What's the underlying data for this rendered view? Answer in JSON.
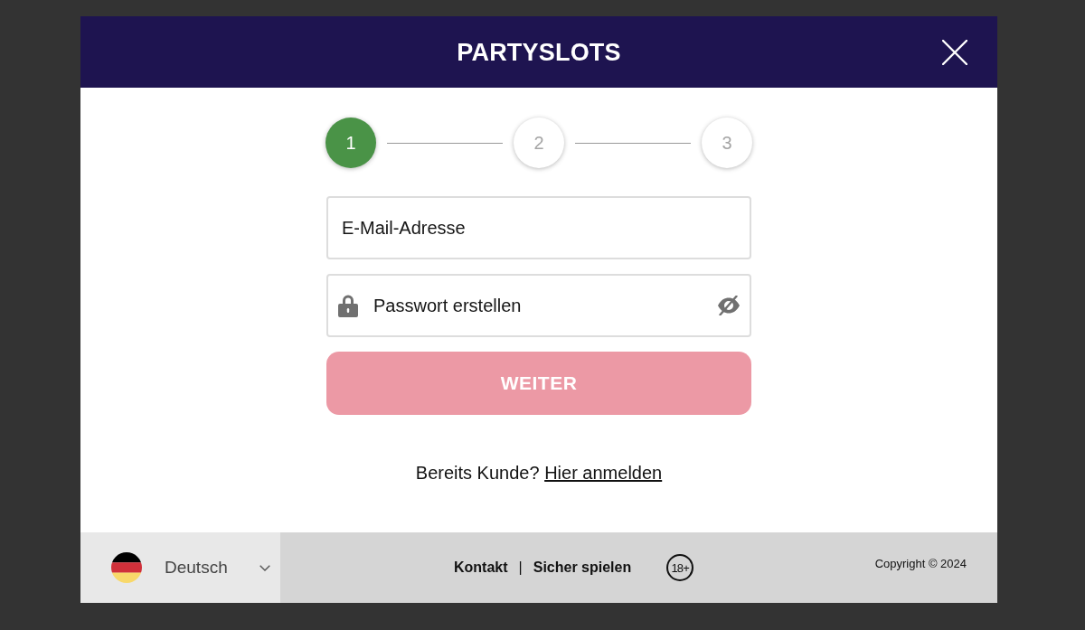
{
  "header": {
    "logo": "PARTYSLOTS"
  },
  "steps": [
    {
      "label": "1",
      "selected": true
    },
    {
      "label": "2",
      "selected": false
    },
    {
      "label": "3",
      "selected": false
    }
  ],
  "form": {
    "fields": [
      {
        "kind": "email",
        "placeholder": "E-Mail-Adresse"
      },
      {
        "kind": "password",
        "placeholder": "Passwort erstellen"
      }
    ],
    "submit": {
      "label": "WEITER",
      "disabled": true
    }
  },
  "login_prompt": {
    "text": "Bereits Kunde?",
    "link": "Hier anmelden"
  },
  "footer": {
    "language": {
      "label": "Deutsch"
    },
    "links": [
      "Kontakt",
      "Sicher spielen"
    ],
    "separator": "|",
    "age_badge": "18+",
    "copyright": "Copyright © 2024"
  }
}
